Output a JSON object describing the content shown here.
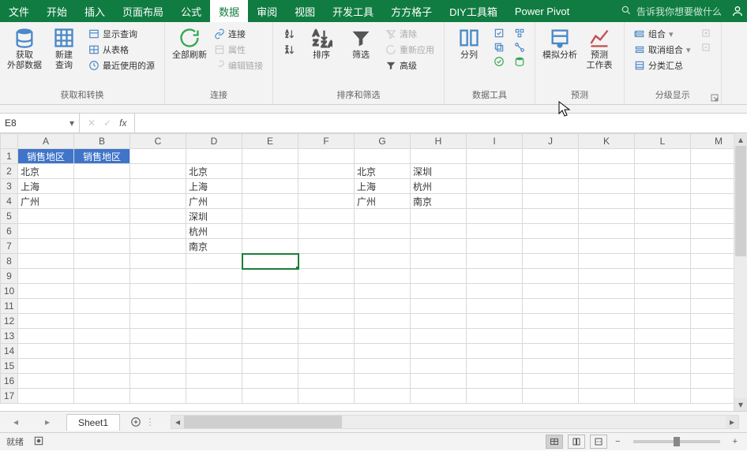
{
  "tabs": {
    "file": "文件",
    "home": "开始",
    "insert": "插入",
    "page_layout": "页面布局",
    "formulas": "公式",
    "data": "数据",
    "review": "审阅",
    "view": "视图",
    "developer": "开发工具",
    "ffgz": "方方格子",
    "diy": "DIY工具箱",
    "power_pivot": "Power Pivot"
  },
  "tell_me": "告诉我你想要做什么",
  "ribbon": {
    "get_external": {
      "cap": "获取\n外部数据"
    },
    "new_query": {
      "cap": "新建\n查询"
    },
    "show_queries": "显示查询",
    "from_table": "从表格",
    "recent_sources": "最近使用的源",
    "group_get_transform": "获取和转换",
    "refresh_all": {
      "cap": "全部刷新"
    },
    "connections": "连接",
    "properties": "属性",
    "edit_links": "编辑链接",
    "group_connections": "连接",
    "sort": {
      "cap": "排序"
    },
    "filter": {
      "cap": "筛选"
    },
    "clear": "清除",
    "reapply": "重新应用",
    "advanced": "高级",
    "group_sort_filter": "排序和筛选",
    "text_to_cols": {
      "cap": "分列"
    },
    "group_data_tools": "数据工具",
    "whatif": {
      "cap": "模拟分析"
    },
    "forecast_sheet": {
      "cap": "预测\n工作表"
    },
    "group_forecast": "预测",
    "group_btn": "组合",
    "ungroup_btn": "取消组合",
    "subtotal": "分类汇总",
    "group_outline": "分级显示"
  },
  "name_box": "E8",
  "columns": [
    "A",
    "B",
    "C",
    "D",
    "E",
    "F",
    "G",
    "H",
    "I",
    "J",
    "K",
    "L",
    "M"
  ],
  "rows": [
    "1",
    "2",
    "3",
    "4",
    "5",
    "6",
    "7",
    "8",
    "9",
    "10",
    "11",
    "12",
    "13",
    "14",
    "15",
    "16",
    "17"
  ],
  "cells": {
    "r1": {
      "A": "销售地区",
      "B": "销售地区"
    },
    "r2": {
      "A": "北京",
      "D": "北京",
      "G": "北京",
      "H": "深圳"
    },
    "r3": {
      "A": "上海",
      "D": "上海",
      "G": "上海",
      "H": "杭州"
    },
    "r4": {
      "A": "广州",
      "D": "广州",
      "G": "广州",
      "H": "南京"
    },
    "r5": {
      "D": "深圳"
    },
    "r6": {
      "D": "杭州"
    },
    "r7": {
      "D": "南京"
    }
  },
  "sheet_tab": "Sheet1",
  "status_ready": "就绪",
  "zoom_minus": "−",
  "zoom_plus": "+"
}
